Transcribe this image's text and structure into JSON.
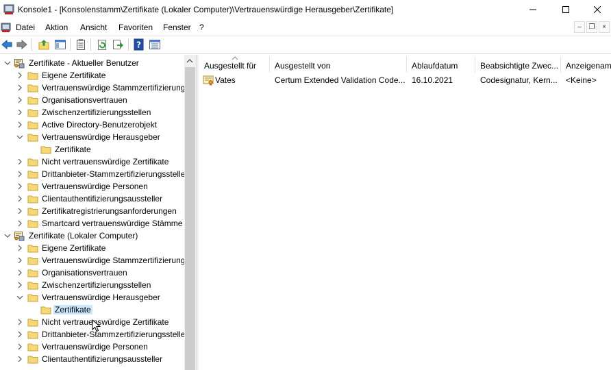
{
  "window": {
    "title": "Konsole1 - [Konsolenstamm\\Zertifikate (Lokaler Computer)\\Vertrauenswürdige Herausgeber\\Zertifikate]",
    "icon": "mmc-console-icon"
  },
  "menu": {
    "items": [
      "Datei",
      "Aktion",
      "Ansicht",
      "Favoriten",
      "Fenster",
      "?"
    ]
  },
  "toolbar": {
    "buttons": [
      "back-icon",
      "forward-icon",
      "up-folder-icon",
      "show-hide-tree-icon",
      "properties-icon",
      "refresh-icon",
      "export-list-icon",
      "help-icon",
      "view-icon"
    ]
  },
  "tree": {
    "nodes": [
      {
        "label": "Zertifikate - Aktueller Benutzer",
        "level": 0,
        "expanded": true,
        "icon": "certificate-store-icon"
      },
      {
        "label": "Eigene Zertifikate",
        "level": 1,
        "expanded": false,
        "icon": "folder-icon"
      },
      {
        "label": "Vertrauenswürdige Stammzertifizierung",
        "level": 1,
        "expanded": false,
        "icon": "folder-icon"
      },
      {
        "label": "Organisationsvertrauen",
        "level": 1,
        "expanded": false,
        "icon": "folder-icon"
      },
      {
        "label": "Zwischenzertifizierungsstellen",
        "level": 1,
        "expanded": false,
        "icon": "folder-icon"
      },
      {
        "label": "Active Directory-Benutzerobjekt",
        "level": 1,
        "expanded": false,
        "icon": "folder-icon"
      },
      {
        "label": "Vertrauenswürdige Herausgeber",
        "level": 1,
        "expanded": true,
        "icon": "folder-icon"
      },
      {
        "label": "Zertifikate",
        "level": 2,
        "leaf": true,
        "icon": "folder-icon"
      },
      {
        "label": "Nicht vertrauenswürdige Zertifikate",
        "level": 1,
        "expanded": false,
        "icon": "folder-icon"
      },
      {
        "label": "Drittanbieter-Stammzertifizierungsstelle",
        "level": 1,
        "expanded": false,
        "icon": "folder-icon"
      },
      {
        "label": "Vertrauenswürdige Personen",
        "level": 1,
        "expanded": false,
        "icon": "folder-icon"
      },
      {
        "label": "Clientauthentifizierungsaussteller",
        "level": 1,
        "expanded": false,
        "icon": "folder-icon"
      },
      {
        "label": "Zertifikatregistrierungsanforderungen",
        "level": 1,
        "expanded": false,
        "icon": "folder-icon"
      },
      {
        "label": "Smartcard vertrauenswürdige Stämme",
        "level": 1,
        "expanded": false,
        "icon": "folder-icon"
      },
      {
        "label": "Zertifikate (Lokaler Computer)",
        "level": 0,
        "expanded": true,
        "icon": "certificate-store-icon"
      },
      {
        "label": "Eigene Zertifikate",
        "level": 1,
        "expanded": false,
        "icon": "folder-icon"
      },
      {
        "label": "Vertrauenswürdige Stammzertifizierung",
        "level": 1,
        "expanded": false,
        "icon": "folder-icon"
      },
      {
        "label": "Organisationsvertrauen",
        "level": 1,
        "expanded": false,
        "icon": "folder-icon"
      },
      {
        "label": "Zwischenzertifizierungsstellen",
        "level": 1,
        "expanded": false,
        "icon": "folder-icon"
      },
      {
        "label": "Vertrauenswürdige Herausgeber",
        "level": 1,
        "expanded": true,
        "icon": "folder-icon"
      },
      {
        "label": "Zertifikate",
        "level": 2,
        "leaf": true,
        "selected": true,
        "icon": "folder-icon"
      },
      {
        "label": "Nicht vertrauenswürdige Zertifikate",
        "level": 1,
        "expanded": false,
        "icon": "folder-icon"
      },
      {
        "label": "Drittanbieter-Stammzertifizierungsstelle",
        "level": 1,
        "expanded": false,
        "icon": "folder-icon"
      },
      {
        "label": "Vertrauenswürdige Personen",
        "level": 1,
        "expanded": false,
        "icon": "folder-icon"
      },
      {
        "label": "Clientauthentifizierungsaussteller",
        "level": 1,
        "expanded": false,
        "icon": "folder-icon"
      }
    ]
  },
  "list": {
    "columns": [
      "Ausgestellt für",
      "Ausgestellt von",
      "Ablaufdatum",
      "Beabsichtigte Zwec...",
      "Anzeigenam"
    ],
    "rows": [
      {
        "issued_to": "Vates",
        "issued_by": "Certum Extended Validation Code...",
        "expiry": "16.10.2021",
        "purposes": "Codesignatur, Kern...",
        "friendly_name": "<Keine>",
        "icon": "certificate-icon"
      }
    ]
  },
  "colors": {
    "selection": "#cce8ff",
    "folder": "#f8d775",
    "accent": "#0078d7"
  }
}
